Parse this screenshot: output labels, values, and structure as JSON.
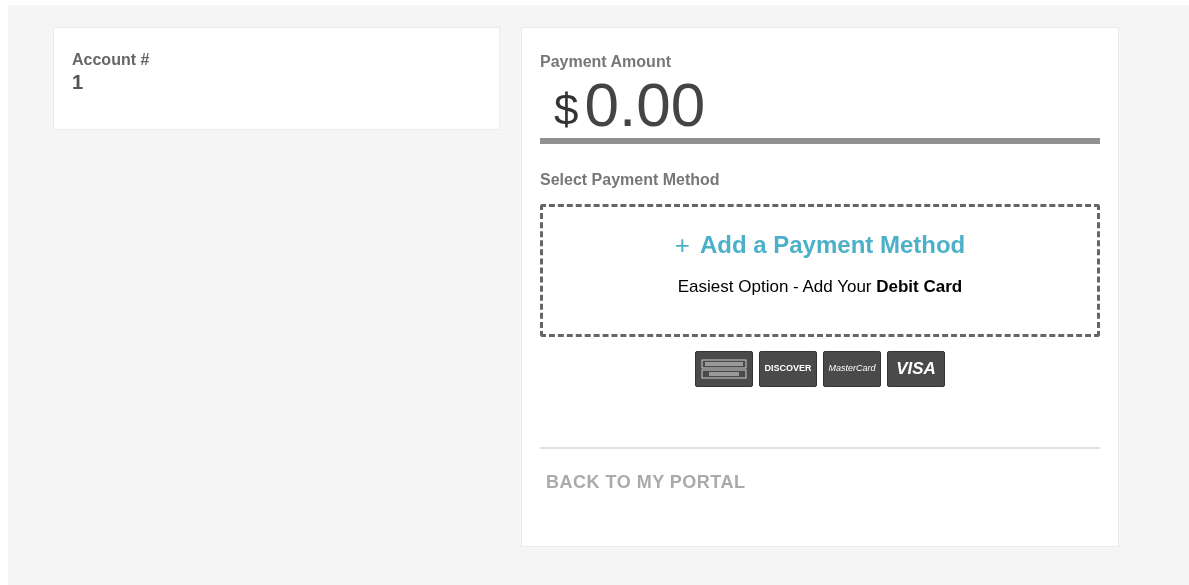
{
  "account": {
    "label": "Account #",
    "value": "1"
  },
  "payment": {
    "label": "Payment Amount",
    "currency": "$",
    "amount": "0.00"
  },
  "method": {
    "label": "Select Payment Method",
    "add_icon": "+",
    "add_label": "Add a Payment Method",
    "hint": "Easiest Option - Add Your **Debit Card**"
  },
  "cards": [
    {
      "kind": "amex"
    },
    {
      "kind": "discover",
      "label": "DISCOVER"
    },
    {
      "kind": "mastercard",
      "label": "MasterCard"
    },
    {
      "kind": "visa",
      "label": "VISA"
    }
  ],
  "back_link": "BACK TO MY PORTAL"
}
